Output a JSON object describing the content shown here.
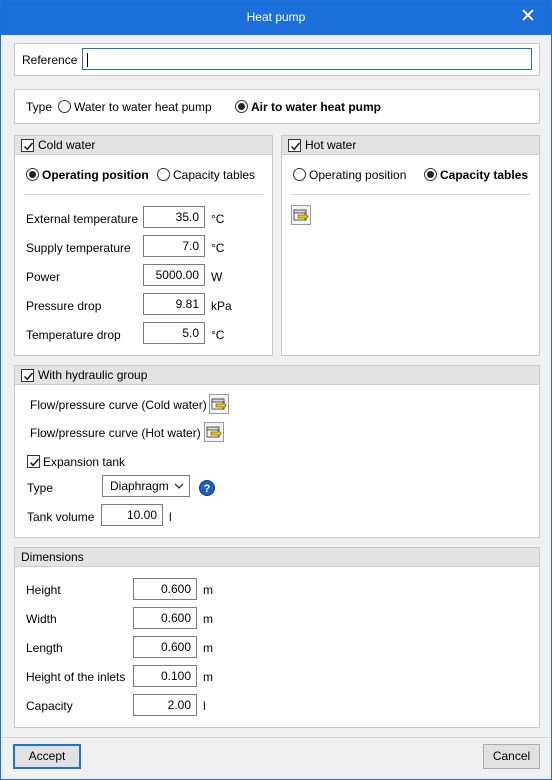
{
  "window": {
    "title": "Heat pump",
    "close_glyph": "✕"
  },
  "reference": {
    "label": "Reference",
    "value": ""
  },
  "type_row": {
    "label": "Type",
    "options": [
      "Water to water heat pump",
      "Air to water heat pump"
    ],
    "selected": "Air to water heat pump"
  },
  "cold_water": {
    "title": "Cold water",
    "checked": true,
    "mode_options": [
      "Operating position",
      "Capacity tables"
    ],
    "selected_mode": "Operating position",
    "fields": [
      {
        "label": "External temperature",
        "value": "35.0",
        "unit": "°C"
      },
      {
        "label": "Supply temperature",
        "value": "7.0",
        "unit": "°C"
      },
      {
        "label": "Power",
        "value": "5000.00",
        "unit": "W"
      },
      {
        "label": "Pressure drop",
        "value": "9.81",
        "unit": "kPa"
      },
      {
        "label": "Temperature drop",
        "value": "5.0",
        "unit": "°C"
      }
    ]
  },
  "hot_water": {
    "title": "Hot water",
    "checked": true,
    "mode_options": [
      "Operating position",
      "Capacity tables"
    ],
    "selected_mode": "Capacity tables",
    "edit_icon": "table-edit-icon"
  },
  "hydraulic_group": {
    "title": "With hydraulic group",
    "checked": true,
    "curve_cold_label": "Flow/pressure curve (Cold water)",
    "curve_hot_label": "Flow/pressure curve (Hot water)",
    "expansion_tank": {
      "label": "Expansion tank",
      "checked": true
    },
    "type_label": "Type",
    "type_value": "Diaphragm",
    "help_glyph": "?",
    "tank_volume": {
      "label": "Tank volume",
      "value": "10.00",
      "unit": "l"
    }
  },
  "dimensions": {
    "title": "Dimensions",
    "fields": [
      {
        "label": "Height",
        "value": "0.600",
        "unit": "m"
      },
      {
        "label": "Width",
        "value": "0.600",
        "unit": "m"
      },
      {
        "label": "Length",
        "value": "0.600",
        "unit": "m"
      },
      {
        "label": "Height of the inlets",
        "value": "0.100",
        "unit": "m"
      },
      {
        "label": "Capacity",
        "value": "2.00",
        "unit": "l"
      }
    ]
  },
  "buttons": {
    "accept": "Accept",
    "cancel": "Cancel"
  },
  "colors": {
    "titlebar": "#1c6ed8",
    "focus_border": "#1a73d9",
    "panel_header": "#e3e3e3"
  }
}
